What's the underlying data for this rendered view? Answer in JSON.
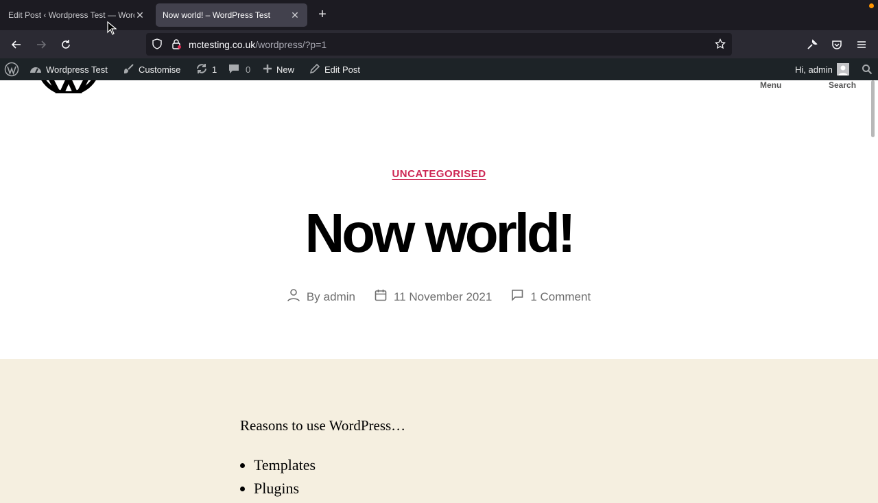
{
  "browser": {
    "tabs": [
      {
        "title": "Edit Post ‹ Wordpress Test — WordPress",
        "active": false
      },
      {
        "title": "Now world! – WordPress Test",
        "active": true
      }
    ],
    "url": {
      "host": "mctesting.co.uk",
      "path": "/wordpress/?p=1"
    }
  },
  "admin_bar": {
    "site_name": "Wordpress Test",
    "customise": "Customise",
    "updates_count": "1",
    "comments_count": "0",
    "new_label": "New",
    "edit_post": "Edit Post",
    "greeting": "Hi, admin"
  },
  "header": {
    "menu_label": "Menu",
    "search_label": "Search"
  },
  "post": {
    "category": "UNCATEGORISED",
    "title": "Now world!",
    "author_prefix": "By",
    "author": "admin",
    "date": "11 November 2021",
    "comments": "1 Comment"
  },
  "content": {
    "intro": "Reasons to use WordPress…",
    "list": [
      "Templates",
      "Plugins"
    ]
  },
  "colors": {
    "accent": "#cd2653",
    "content_bg": "#f5efe0",
    "admin_bar_bg": "#1d2327"
  }
}
